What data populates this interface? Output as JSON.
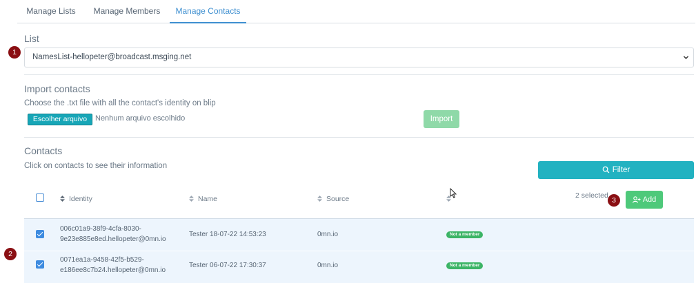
{
  "tabs": [
    {
      "label": "Manage Lists",
      "active": false
    },
    {
      "label": "Manage Members",
      "active": false
    },
    {
      "label": "Manage Contacts",
      "active": true
    }
  ],
  "list_section": {
    "title": "List",
    "selected_value": "NamesList-hellopeter@broadcast.msging.net"
  },
  "import_section": {
    "title": "Import contacts",
    "hint": "Choose the .txt file with all the contact's identity on blip",
    "file_button_label": "Escolher arquivo",
    "file_status": "Nenhum arquivo escolhido",
    "import_button_label": "Import"
  },
  "contacts_section": {
    "title": "Contacts",
    "hint": "Click on contacts to see their information",
    "filter_button_label": "Filter",
    "selected_count_text": "2 selected",
    "add_button_label": "Add",
    "columns": [
      "Identity",
      "Name",
      "Source"
    ],
    "rows": [
      {
        "checked": true,
        "identity_line1": "006c01a9-38f9-4cfa-8030-",
        "identity_line2": "9e23e885e8ed.hellopeter@0mn.io",
        "name": "Tester 18-07-22 14:53:23",
        "source": "0mn.io",
        "status": "Not a member"
      },
      {
        "checked": true,
        "identity_line1": "0071ea1a-9458-42f5-b529-",
        "identity_line2": "e186ee8c7b24.hellopeter@0mn.io",
        "name": "Tester 06-07-22 17:30:37",
        "source": "0mn.io",
        "status": "Not a member"
      }
    ]
  },
  "markers": [
    "1",
    "2",
    "3"
  ],
  "colors": {
    "accent": "#3e8fd0",
    "teal": "#22b2c1",
    "green": "#4ec97a",
    "marker": "#8a0f13",
    "row_bg": "#edf5fd"
  }
}
